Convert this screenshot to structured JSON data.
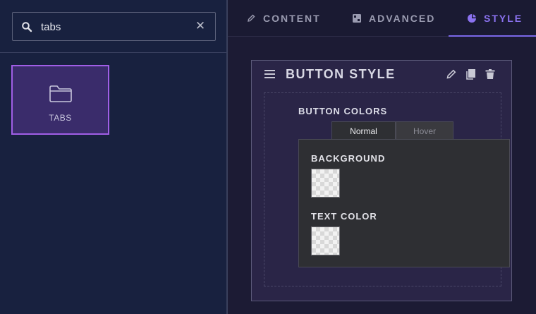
{
  "search": {
    "value": "tabs",
    "clear_glyph": "✕",
    "icon": "search-icon"
  },
  "widgets": [
    {
      "label": "TABS",
      "icon": "folder-icon"
    }
  ],
  "editor_tabs": [
    {
      "label": "CONTENT",
      "icon": "pencil-icon"
    },
    {
      "label": "ADVANCED",
      "icon": "grid-icon"
    },
    {
      "label": "STYLE",
      "icon": "palette-icon",
      "active": true
    }
  ],
  "panel": {
    "title": "BUTTON STYLE",
    "section_label": "BUTTON COLORS",
    "states": [
      {
        "label": "Normal",
        "active": true
      },
      {
        "label": "Hover"
      }
    ],
    "fields": [
      {
        "label": "BACKGROUND"
      },
      {
        "label": "TEXT COLOR"
      }
    ]
  },
  "colors": {
    "accent": "#8b72f0",
    "selected_border": "#a05ee6",
    "left_bg": "#18213f",
    "right_bg": "#1c1b34"
  }
}
